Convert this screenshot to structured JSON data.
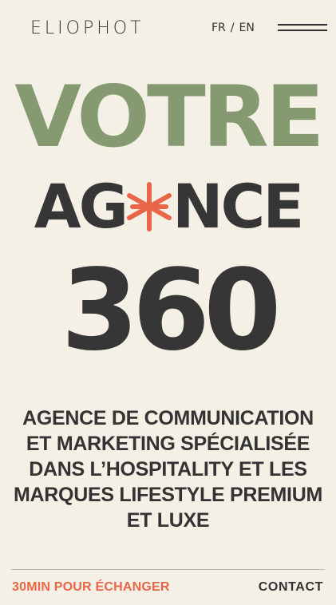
{
  "header": {
    "logo": "ELIOPHOT",
    "lang": {
      "fr": "FR",
      "sep": "/",
      "en": "EN"
    },
    "menu_icon": "hamburger-menu-icon"
  },
  "hero": {
    "line1": "VOTRE",
    "line2_before": "AG",
    "line2_after": "NCE",
    "line3": "360",
    "star_icon": "asterisk-icon",
    "colors": {
      "green": "#869a72",
      "dark": "#363636",
      "accent": "#e86548",
      "background": "#f5f0e6"
    }
  },
  "tagline": "AGENCE DE COMMUNICATION ET MARKETING SPÉCIALISÉE DANS L’HOSPITALITY ET LES MARQUES LIFESTYLE PREMIUM ET LUXE",
  "footer": {
    "cta_left": "30MIN POUR ÉCHANGER",
    "cta_right": "CONTACT"
  }
}
